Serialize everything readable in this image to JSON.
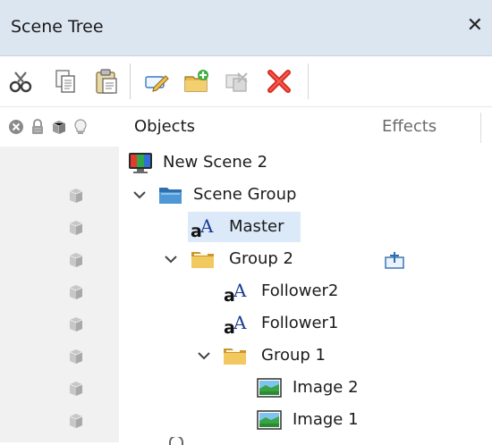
{
  "window": {
    "title": "Scene Tree",
    "close_label": "✕"
  },
  "toolbar": {
    "buttons": [
      {
        "icon": "cut-icon"
      },
      {
        "icon": "copy-icon"
      },
      {
        "icon": "paste-icon"
      },
      {
        "icon": "rename-icon"
      },
      {
        "icon": "add-folder-icon"
      },
      {
        "icon": "merge-disabled-icon"
      },
      {
        "icon": "delete-icon"
      }
    ],
    "field_value": ""
  },
  "columns": {
    "objects": "Objects",
    "effects": "Effects",
    "header_icons": [
      "lock-x-icon",
      "padlock-icon",
      "cube-icon",
      "lightbulb-icon"
    ]
  },
  "tree": [
    {
      "label": "New Scene 2",
      "icon": "scene-icon",
      "depth": 0,
      "expander": "none",
      "visibility_cube": false,
      "selected": false
    },
    {
      "label": "Scene Group",
      "icon": "folder-blue-icon",
      "depth": 1,
      "expander": "expanded",
      "visibility_cube": true,
      "selected": false
    },
    {
      "label": "Master",
      "icon": "text-object-icon",
      "depth": 2,
      "expander": "none",
      "visibility_cube": true,
      "selected": true
    },
    {
      "label": "Group 2",
      "icon": "folder-yellow-icon",
      "depth": 2,
      "expander": "expanded",
      "visibility_cube": true,
      "selected": false,
      "effect_icon": "effect-link-icon"
    },
    {
      "label": "Follower2",
      "icon": "text-object-icon",
      "depth": 3,
      "expander": "none",
      "visibility_cube": true,
      "selected": false
    },
    {
      "label": "Follower1",
      "icon": "text-object-icon",
      "depth": 3,
      "expander": "none",
      "visibility_cube": true,
      "selected": false
    },
    {
      "label": "Group 1",
      "icon": "folder-yellow-icon",
      "depth": 3,
      "expander": "expanded",
      "visibility_cube": true,
      "selected": false
    },
    {
      "label": "Image 2",
      "icon": "image-object-icon",
      "depth": 4,
      "expander": "none",
      "visibility_cube": true,
      "selected": false
    },
    {
      "label": "Image 1",
      "icon": "image-object-icon",
      "depth": 4,
      "expander": "none",
      "visibility_cube": true,
      "selected": false
    }
  ],
  "colors": {
    "titlebar": "#dce6f1",
    "selection": "#dbe9f8",
    "left_strip": "#f1f1f1",
    "folder_blue": "#3d86c6",
    "folder_yellow": "#e8b94b",
    "delete_red": "#d9261c"
  }
}
